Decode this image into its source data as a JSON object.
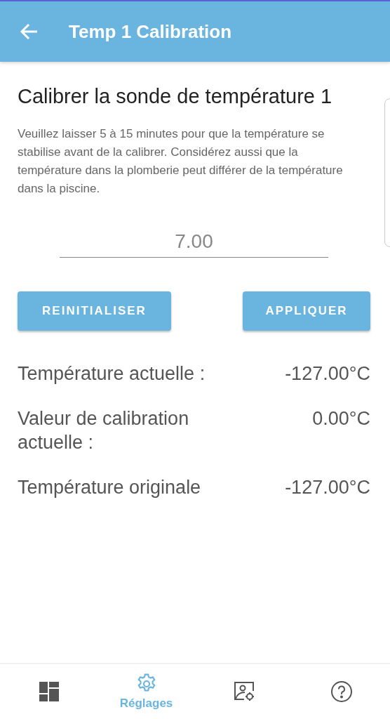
{
  "app_bar": {
    "title": "Temp 1 Calibration"
  },
  "heading": "Calibrer la sonde de température 1",
  "description": "Veuillez laisser 5 à 15 minutes pour que la température se stabilise avant de la calibrer. Considérez aussi que la température dans la plomberie peut différer de la température dans la piscine.",
  "calibration_field": {
    "value": "7.00"
  },
  "buttons": [
    {
      "label": "REINITIALISER"
    },
    {
      "label": "APPLIQUER"
    }
  ],
  "readings": [
    {
      "label": "Température actuelle :",
      "value": "-127.00°C"
    },
    {
      "label": "Valeur de calibration actuelle :",
      "value": "0.00°C"
    },
    {
      "label": "Température originale",
      "value": "-127.00°C"
    }
  ],
  "bottom_nav": [
    {
      "kind": "dashboard",
      "selected": false
    },
    {
      "kind": "settings",
      "selected": true,
      "label": "Réglages"
    },
    {
      "kind": "device",
      "selected": false
    },
    {
      "kind": "help",
      "selected": false
    }
  ]
}
